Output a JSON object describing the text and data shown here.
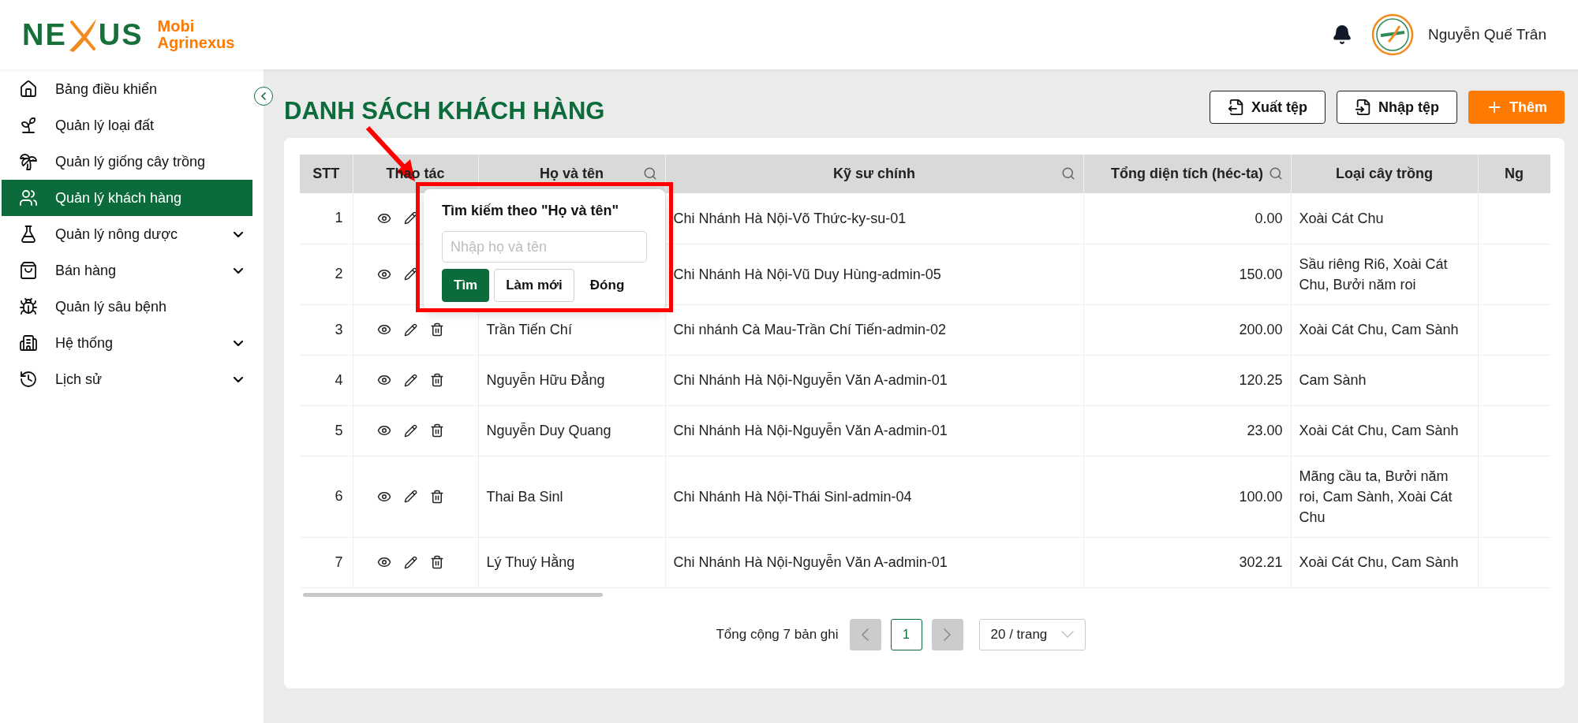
{
  "brand": {
    "logo_left": "NE",
    "logo_right": "US",
    "name_line1": "Mobi",
    "name_line2": "Agrinexus"
  },
  "user": {
    "name": "Nguyễn Quế Trân"
  },
  "sidebar": {
    "items": [
      {
        "label": "Bảng điều khiển",
        "selected": false,
        "has_submenu": false
      },
      {
        "label": "Quản lý loại đất",
        "selected": false,
        "has_submenu": false
      },
      {
        "label": "Quản lý giống cây trồng",
        "selected": false,
        "has_submenu": false
      },
      {
        "label": "Quản lý khách hàng",
        "selected": true,
        "has_submenu": false
      },
      {
        "label": "Quản lý nông dược",
        "selected": false,
        "has_submenu": true
      },
      {
        "label": "Bán hàng",
        "selected": false,
        "has_submenu": true
      },
      {
        "label": "Quản lý sâu bệnh",
        "selected": false,
        "has_submenu": false
      },
      {
        "label": "Hệ thống",
        "selected": false,
        "has_submenu": true
      },
      {
        "label": "Lịch sử",
        "selected": false,
        "has_submenu": true
      }
    ]
  },
  "page": {
    "title": "DANH SÁCH KHÁCH HÀNG",
    "actions": [
      {
        "label": "Xuất tệp",
        "kind": "export"
      },
      {
        "label": "Nhập tệp",
        "kind": "import"
      },
      {
        "label": "Thêm",
        "kind": "add"
      }
    ]
  },
  "table": {
    "columns": [
      {
        "label": "STT",
        "searchable": false
      },
      {
        "label": "Thao tác",
        "searchable": false
      },
      {
        "label": "Họ và tên",
        "searchable": true
      },
      {
        "label": "Kỹ sư chính",
        "searchable": true
      },
      {
        "label": "Tổng diện tích (héc-ta)",
        "searchable": true
      },
      {
        "label": "Loại cây trồng",
        "searchable": false
      },
      {
        "label": "Ng",
        "searchable": false
      }
    ],
    "rows": [
      {
        "stt": "1",
        "engineer": "Chi Nhánh Hà Nội-Võ Thức-ky-su-01",
        "area": "0.00",
        "crops": "Xoài Cát Chu"
      },
      {
        "stt": "2",
        "engineer": "Chi Nhánh Hà Nội-Vũ Duy Hùng-admin-05",
        "area": "150.00",
        "crops": "Sầu riêng Ri6, Xoài Cát Chu, Bưởi năm roi"
      },
      {
        "stt": "3",
        "name": "Trần Tiến Chí",
        "engineer": "Chi nhánh Cà Mau-Trần Chí Tiến-admin-02",
        "area": "200.00",
        "crops": "Xoài Cát Chu, Cam Sành"
      },
      {
        "stt": "4",
        "name": "Nguyễn Hữu Đẳng",
        "engineer": "Chi Nhánh Hà Nội-Nguyễn Văn A-admin-01",
        "area": "120.25",
        "crops": "Cam Sành"
      },
      {
        "stt": "5",
        "name": "Nguyễn Duy Quang",
        "engineer": "Chi Nhánh Hà Nội-Nguyễn Văn A-admin-01",
        "area": "23.00",
        "crops": "Xoài Cát Chu, Cam Sành"
      },
      {
        "stt": "6",
        "name": "Thai Ba Sinl",
        "engineer": "Chi Nhánh Hà Nội-Thái Sinl-admin-04",
        "area": "100.00",
        "crops": "Mãng cầu ta, Bưởi năm roi, Cam Sành, Xoài Cát Chu"
      },
      {
        "stt": "7",
        "name": "Lý Thuý Hằng",
        "engineer": "Chi Nhánh Hà Nội-Nguyễn Văn A-admin-01",
        "area": "302.21",
        "crops": "Xoài Cát Chu, Cam Sành"
      }
    ]
  },
  "search_popup": {
    "title": "Tìm kiếm theo \"Họ và tên\"",
    "placeholder": "Nhập họ và tên",
    "buttons": [
      {
        "label": "Tìm",
        "kind": "primary"
      },
      {
        "label": "Làm mới",
        "kind": "outline"
      },
      {
        "label": "Đóng",
        "kind": "text"
      }
    ]
  },
  "pagination": {
    "total_text": "Tổng cộng 7 bản ghi",
    "prev_disabled": true,
    "next_disabled": true,
    "pages": [
      {
        "label": "1",
        "selected": true
      }
    ],
    "page_size": "20 / trang"
  }
}
